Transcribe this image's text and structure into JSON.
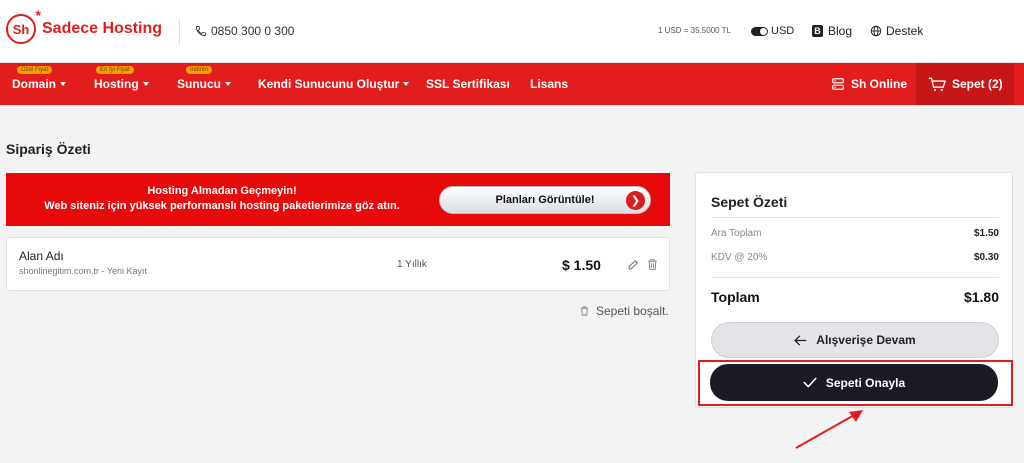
{
  "header": {
    "brand_short": "Sh",
    "brand_name": "Sadece Hosting",
    "phone": "0850 300 0 300",
    "exchange_rate": "1 USD = 35.5000 TL",
    "currency": "USD",
    "blog": "Blog",
    "support": "Destek"
  },
  "nav": {
    "items": [
      {
        "label": "Domain",
        "badge": "Özel Fiyat"
      },
      {
        "label": "Hosting",
        "badge": "En İyi Fiyat"
      },
      {
        "label": "Sunucu",
        "badge": "İndirim"
      },
      {
        "label": "Kendi Sunucunu Oluştur"
      },
      {
        "label": "SSL Sertifikası"
      },
      {
        "label": "Lisans"
      }
    ],
    "sh_online": "Sh Online",
    "cart": "Sepet (2)"
  },
  "page": {
    "title": "Sipariş Özeti"
  },
  "promo": {
    "line1": "Hosting Almadan Geçmeyin!",
    "line2": "Web siteniz için yüksek performanslı hosting paketlerimize göz atın.",
    "button": "Planları Görüntüle!"
  },
  "cart_item": {
    "name": "Alan Adı",
    "detail": "shonlinegitim.com.tr - Yeni Kayıt",
    "period": "1 Yıllık",
    "price": "$ 1.50"
  },
  "empty_cart": "Sepeti boşalt.",
  "summary": {
    "title": "Sepet Özeti",
    "subtotal_label": "Ara Toplam",
    "subtotal_value": "$1.50",
    "tax_label": "KDV @ 20%",
    "tax_value": "$0.30",
    "total_label": "Toplam",
    "total_value": "$1.80",
    "continue_button": "Alışverişe Devam",
    "confirm_button": "Sepeti Onayla"
  },
  "colors": {
    "brand_red": "#e11d1d",
    "confirm_dark": "#1b1b24",
    "annotation": "#e11d1d"
  }
}
